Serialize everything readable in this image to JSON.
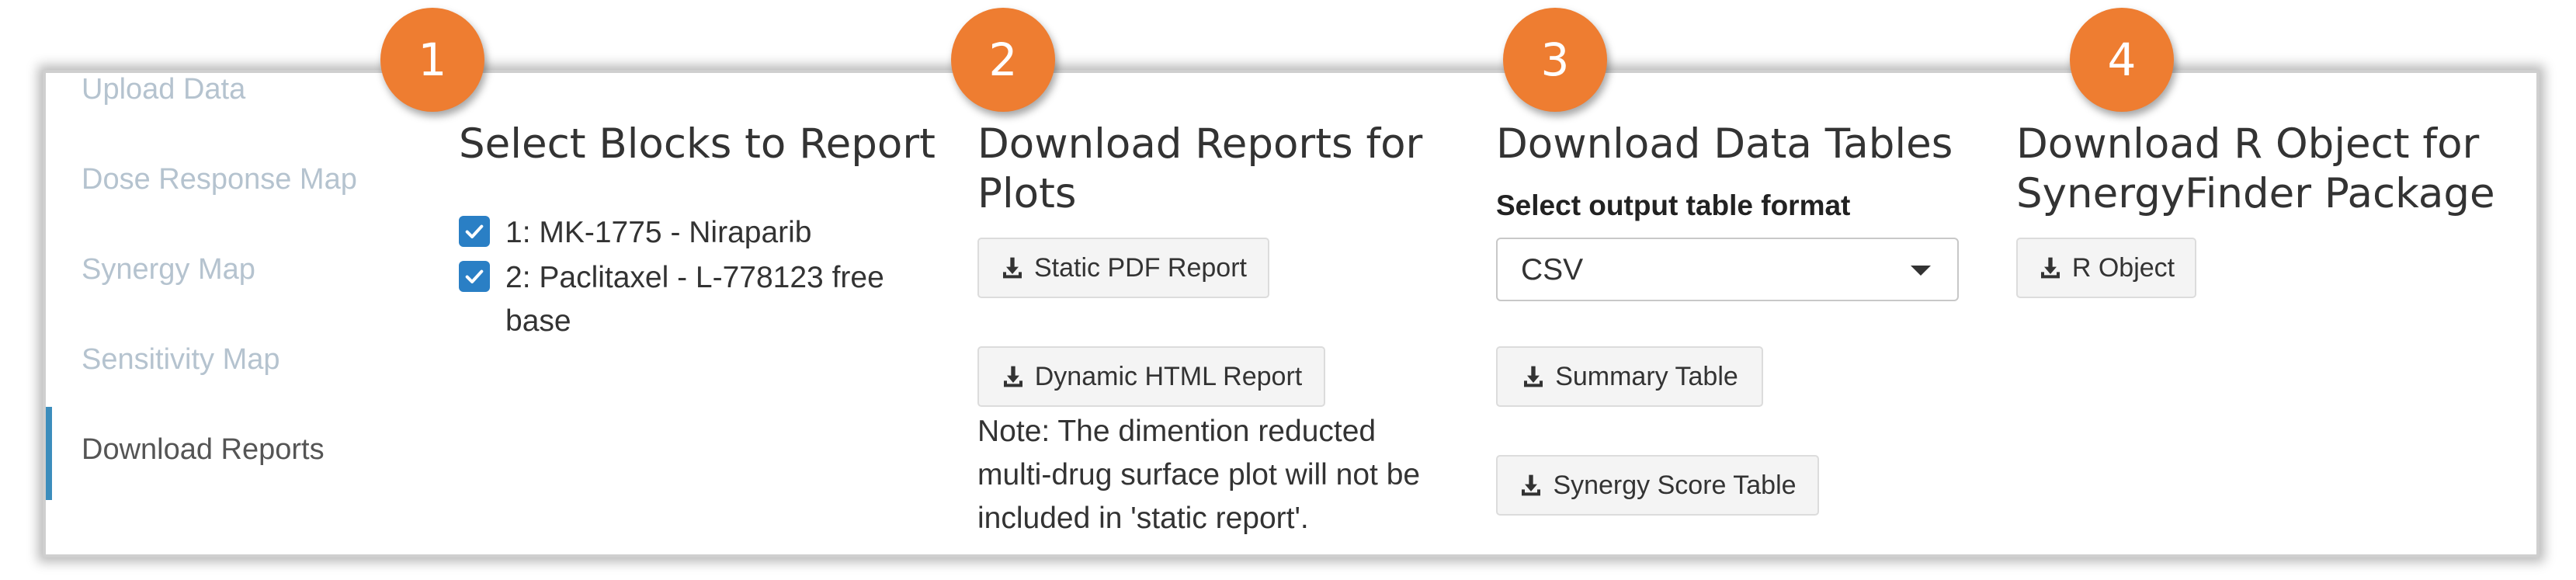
{
  "sidebar": {
    "items": [
      {
        "label": "Upload Data"
      },
      {
        "label": "Dose Response Map"
      },
      {
        "label": "Synergy Map"
      },
      {
        "label": "Sensitivity Map"
      },
      {
        "label": "Download Reports"
      }
    ],
    "active_index": 4
  },
  "badges": [
    "1",
    "2",
    "3",
    "4"
  ],
  "blocks": {
    "heading": "Select Blocks to Report",
    "items": [
      {
        "line1": "1: MK-1775 - Niraparib",
        "line2": "",
        "checked": true
      },
      {
        "line1": "2: Paclitaxel - L-778123 free",
        "line2": "base",
        "checked": true
      }
    ]
  },
  "plots": {
    "heading_line1": "Download Reports for",
    "heading_line2": "Plots",
    "static_pdf_label": "Static PDF Report",
    "dynamic_html_label": "Dynamic HTML Report",
    "note_lines": [
      "Note: The dimention reducted",
      "multi-drug surface plot will not be",
      "included in 'static report'."
    ]
  },
  "tables": {
    "heading": "Download Data Tables",
    "format_label": "Select output table format",
    "format_value": "CSV",
    "summary_label": "Summary Table",
    "synergy_label": "Synergy Score Table"
  },
  "robject": {
    "heading_line1": "Download R Object for",
    "heading_line2": "SynergyFinder Package",
    "button_label": "R Object"
  },
  "colors": {
    "badge": "#ee7d31",
    "accent": "#3c8dbc",
    "checkbox": "#2a7fc5"
  }
}
